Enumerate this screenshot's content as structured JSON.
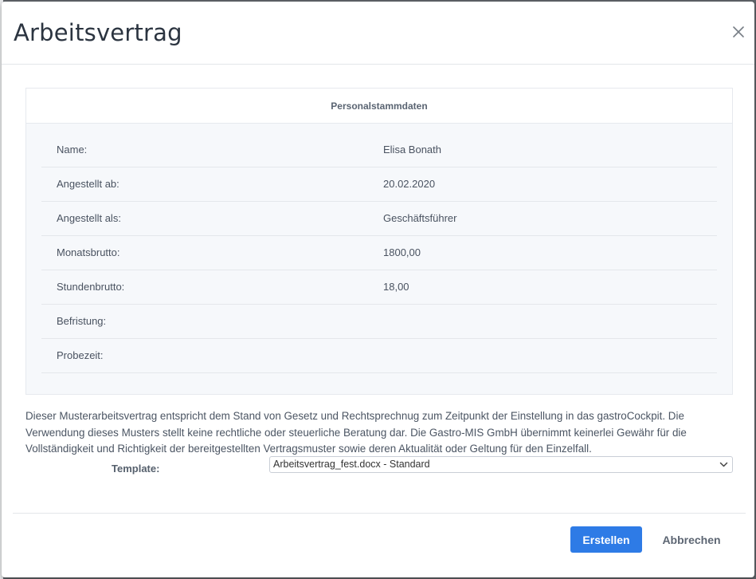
{
  "dialog": {
    "title": "Arbeitsvertrag",
    "close_icon": "close-icon"
  },
  "panel": {
    "header": "Personalstammdaten",
    "rows": [
      {
        "label": "Name:",
        "value": "Elisa Bonath"
      },
      {
        "label": "Angestellt ab:",
        "value": "20.02.2020"
      },
      {
        "label": "Angestellt als:",
        "value": "Geschäftsführer"
      },
      {
        "label": "Monatsbrutto:",
        "value": "1800,00"
      },
      {
        "label": "Stundenbrutto:",
        "value": "18,00"
      },
      {
        "label": "Befristung:",
        "value": ""
      },
      {
        "label": "Probezeit:",
        "value": ""
      }
    ]
  },
  "disclaimer": "Dieser Musterarbeitsvertrag entspricht dem Stand von Gesetz und Rechtsprechnug zum Zeitpunkt der Einstellung in das gastroCockpit. Die Verwendung dieses Musters stellt keine rechtliche oder steuerliche Beratung dar. Die Gastro-MIS GmbH übernimmt keinerlei Gewähr für die Vollständigkeit und Richtigkeit der bereitgestellten Vertragsmuster sowie deren Aktualität oder Geltung für den Einzelfall.",
  "template": {
    "label": "Template:",
    "selected": "Arbeitsvertrag_fest.docx - Standard",
    "chevron_icon": "chevron-down-icon"
  },
  "footer": {
    "create_label": "Erstellen",
    "cancel_label": "Abbrechen"
  },
  "colors": {
    "primary": "#2e7be6",
    "title": "#2b3440",
    "panel_bg": "#f6f8fb"
  }
}
